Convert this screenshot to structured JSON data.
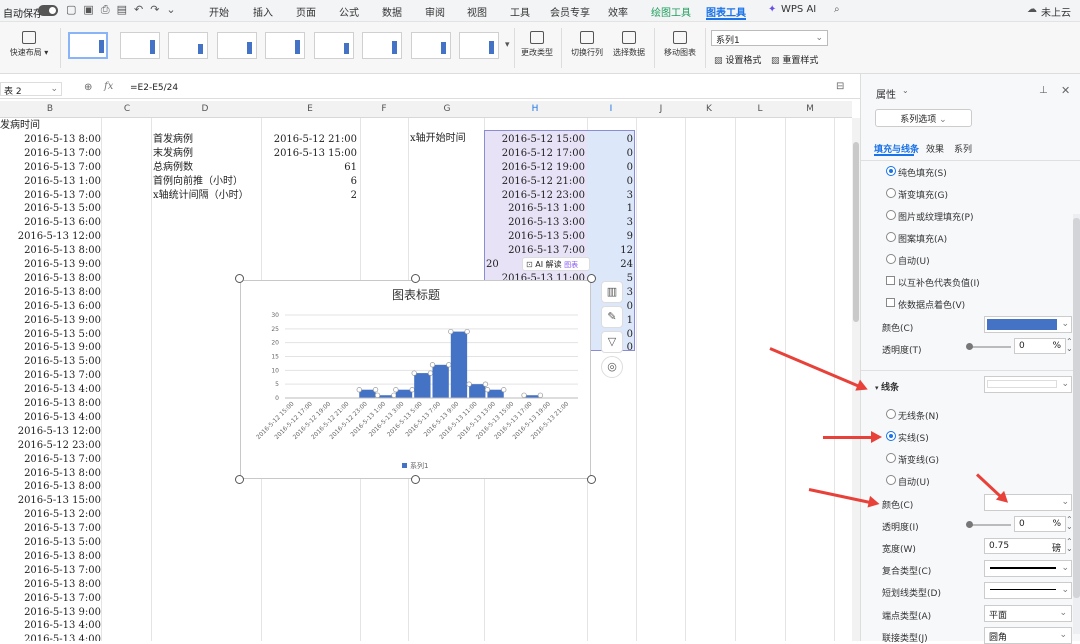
{
  "topbar": {
    "autosave": "自动保存",
    "tabs": [
      "开始",
      "插入",
      "页面",
      "公式",
      "数据",
      "审阅",
      "视图",
      "工具",
      "会员专享",
      "效率",
      "绘图工具",
      "图表工具",
      "WPS AI"
    ],
    "cloud": "未上云"
  },
  "ribbon": {
    "quick_layout": "快速布局",
    "change_type": "更改类型",
    "switch_rowcol": "切换行列",
    "select_data": "选择数据",
    "move_chart": "移动图表",
    "series_select": "系列1",
    "format_sel": "设置格式",
    "reset_style": "重置样式"
  },
  "formula": {
    "namebox": "表 2",
    "fx": "fx",
    "formula": "=E2-E5/24"
  },
  "columns": [
    "B",
    "C",
    "D",
    "E",
    "F",
    "G",
    "H",
    "I",
    "J",
    "K",
    "L",
    "M"
  ],
  "sheet": {
    "b_header": "发病时间",
    "b_col": [
      "2016-5-13 8:00",
      "2016-5-13 7:00",
      "2016-5-13 7:00",
      "2016-5-13 1:00",
      "2016-5-13 7:00",
      "2016-5-13 5:00",
      "2016-5-13 6:00",
      "2016-5-13 12:00",
      "2016-5-13 8:00",
      "2016-5-13 9:00",
      "2016-5-13 8:00",
      "2016-5-13 8:00",
      "2016-5-13 6:00",
      "2016-5-13 9:00",
      "2016-5-13 5:00",
      "2016-5-13 9:00",
      "2016-5-13 5:00",
      "2016-5-13 7:00",
      "2016-5-13 4:00",
      "2016-5-13 8:00",
      "2016-5-13 4:00",
      "2016-5-13 12:00",
      "2016-5-12 23:00",
      "2016-5-13 7:00",
      "2016-5-13 8:00",
      "2016-5-13 8:00",
      "2016-5-13 15:00",
      "2016-5-13 2:00",
      "2016-5-13 7:00",
      "2016-5-13 5:00",
      "2016-5-13 8:00",
      "2016-5-13 7:00",
      "2016-5-13 8:00",
      "2016-5-13 7:00",
      "2016-5-13 9:00",
      "2016-5-13 4:00",
      "2016-5-13 4:00"
    ],
    "d_col": [
      "首发病例",
      "末发病例",
      "总病例数",
      "首例向前推（小时）",
      "x轴统计间隔（小时）"
    ],
    "e_col": [
      "2016-5-12 21:00",
      "2016-5-13 15:00",
      "61",
      "6",
      "2"
    ],
    "g_label": "x轴开始时间",
    "h_col": [
      "2016-5-12 15:00",
      "2016-5-12 17:00",
      "2016-5-12 19:00",
      "2016-5-12 21:00",
      "2016-5-12 23:00",
      "2016-5-13 1:00",
      "2016-5-13 3:00",
      "2016-5-13 5:00",
      "2016-5-13 7:00",
      "20",
      "2016-5-13 11:00"
    ],
    "i_col": [
      "0",
      "0",
      "0",
      "0",
      "3",
      "1",
      "3",
      "9",
      "12",
      "24",
      "5",
      "3",
      "0",
      "1",
      "0",
      "0"
    ]
  },
  "ai_popup": {
    "label": "AI 解读",
    "tag": "图表"
  },
  "chart_data": {
    "type": "bar",
    "title": "图表标题",
    "categories": [
      "2016-5-12 15:00",
      "2016-5-12 17:00",
      "2016-5-12 19:00",
      "2016-5-12 21:00",
      "2016-5-12 23:00",
      "2016-5-13 1:00",
      "2016-5-13 3:00",
      "2016-5-13 5:00",
      "2016-5-13 7:00",
      "2016-5-13 9:00",
      "2016-5-13 11:00",
      "2016-5-13 13:00",
      "2016-5-13 15:00",
      "2016-5-13 17:00",
      "2016-5-13 19:00",
      "2016-5-13 21:00"
    ],
    "series": [
      {
        "name": "系列1",
        "values": [
          0,
          0,
          0,
          0,
          3,
          1,
          3,
          9,
          12,
          24,
          5,
          3,
          0,
          1,
          0,
          0
        ]
      }
    ],
    "yticks": [
      "0",
      "5",
      "10",
      "15",
      "20",
      "25",
      "30"
    ],
    "ylim": [
      0,
      30
    ],
    "color": "#4472c4",
    "legend": "bottom",
    "grid": true
  },
  "panel": {
    "title": "属性",
    "series_option": "系列选项",
    "tabs": [
      "填充与线条",
      "效果",
      "系列"
    ],
    "fill_options": [
      "纯色填充(S)",
      "渐变填充(G)",
      "图片或纹理填充(P)",
      "图案填充(A)",
      "自动(U)"
    ],
    "fill_checks": [
      "以互补色代表负值(I)",
      "依数据点着色(V)"
    ],
    "color_label": "颜色(C)",
    "transparency_label": "透明度(T)",
    "transparency_value": "0",
    "percent": "%",
    "line_section": "线条",
    "line_options": [
      "无线条(N)",
      "实线(S)",
      "渐变线(G)",
      "自动(U)"
    ],
    "line_color_label": "颜色(C)",
    "line_transparency_label": "透明度(I)",
    "line_transparency_value": "0",
    "width_label": "宽度(W)",
    "width_value": "0.75",
    "width_unit": "磅",
    "compound_label": "复合类型(C)",
    "dash_label": "短划线类型(D)",
    "cap_label": "端点类型(A)",
    "cap_value": "平面",
    "join_label": "联接类型(J)",
    "join_value": "圆角"
  },
  "colors": {
    "fill": "#4472c4",
    "accent": "#1a73e8",
    "arrow": "#e8413a"
  }
}
